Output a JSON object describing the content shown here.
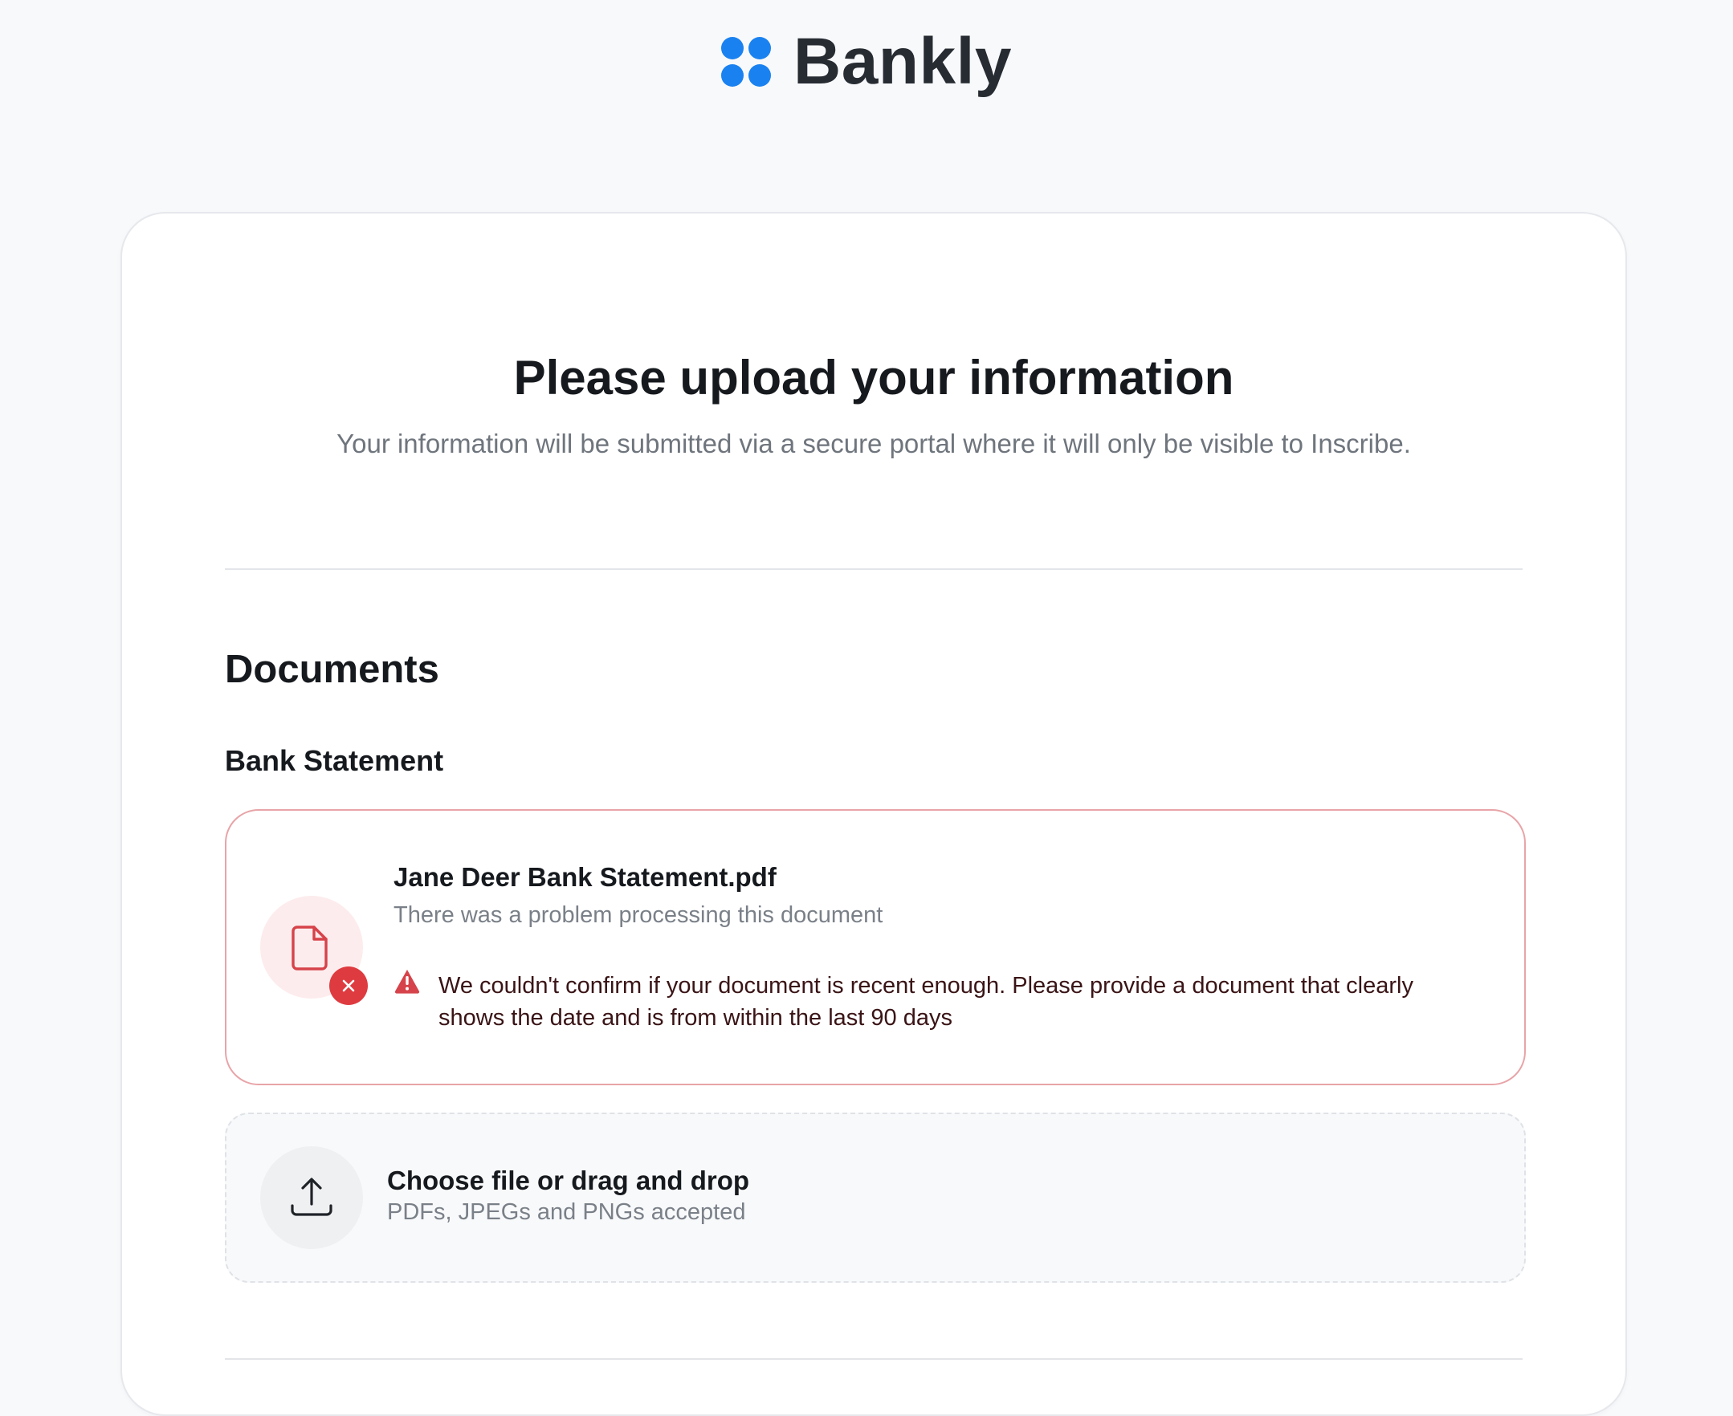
{
  "brand": {
    "name": "Bankly",
    "logo_icon": "four-dots-logo-icon",
    "accent_color": "#1a82f0"
  },
  "header": {
    "title": "Please upload your information",
    "subtitle": "Your information will be submitted via a secure portal where it will only be visible to Inscribe."
  },
  "documents": {
    "section_title": "Documents",
    "items": [
      {
        "label": "Bank Statement",
        "uploaded_file": {
          "name": "Jane Deer Bank Statement.pdf",
          "status": "There was a problem processing this document",
          "file_icon": "document-icon",
          "badge_icon": "close-icon",
          "warning_icon": "warning-triangle-icon",
          "error_message": "We couldn't confirm if your document is recent enough. Please provide a document that clearly shows the date and is from within the last 90 days",
          "error_color": "#de3b40"
        },
        "dropzone": {
          "icon": "upload-icon",
          "title": "Choose file or drag and drop",
          "hint": "PDFs, JPEGs and PNGs accepted"
        }
      }
    ]
  }
}
